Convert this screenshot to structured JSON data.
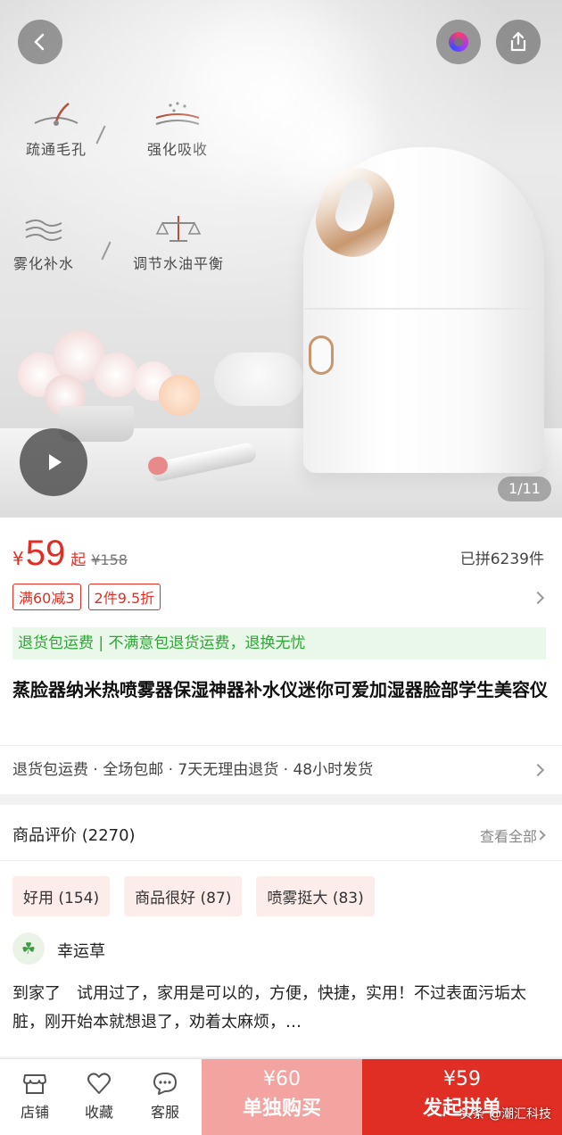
{
  "hero": {
    "features": [
      {
        "icon": "pore-icon",
        "label": "疏通毛孔"
      },
      {
        "icon": "absorb-icon",
        "label": "强化吸收"
      },
      {
        "icon": "mist-icon",
        "label": "雾化补水"
      },
      {
        "icon": "balance-icon",
        "label": "调节水油平衡"
      }
    ],
    "image_counter": "1/11"
  },
  "price": {
    "currency": "¥",
    "amount": "59",
    "suffix": "起",
    "original": "¥158",
    "sold": "已拼6239件"
  },
  "promo_tags": [
    "满60减3",
    "2件9.5折"
  ],
  "guarantee": "退货包运费 | 不满意包退货运费，退换无忧",
  "product_title": "蒸脸器纳米热喷雾器保湿神器补水仪迷你可爱加湿器脸部学生美容仪",
  "services": "退货包运费 · 全场包邮 · 7天无理由退货 · 48小时发货",
  "reviews": {
    "header": "商品评价 (2270)",
    "see_all": "查看全部",
    "tags": [
      "好用 (154)",
      "商品很好 (87)",
      "喷雾挺大 (83)"
    ],
    "user": "幸运草",
    "text": "到家了　试用过了，家用是可以的，方便，快捷，实用！不过表面污垢太脏，刚开始本就想退了，劝着太麻烦，…"
  },
  "bottom_bar": {
    "store": "店铺",
    "favorite": "收藏",
    "service": "客服",
    "solo_price": "¥60",
    "solo_label": "单独购买",
    "group_price": "¥59",
    "group_label": "发起拼单"
  },
  "watermark": "头条 @潮汇科技",
  "colors": {
    "accent": "#e02e24",
    "guarantee_green": "#2aa834",
    "solo_bg": "#f3a3a0"
  }
}
